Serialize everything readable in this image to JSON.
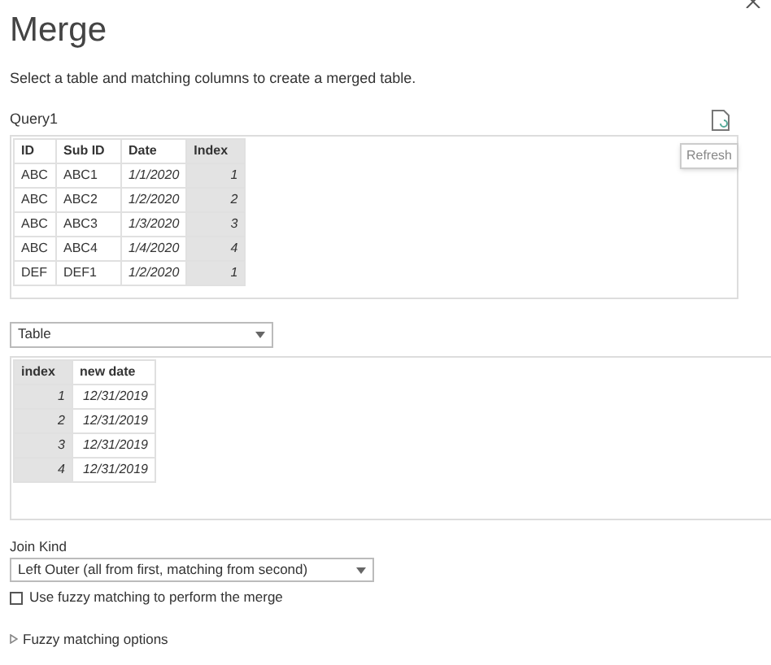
{
  "title": "Merge",
  "description": "Select a table and matching columns to create a merged table.",
  "first_table": {
    "name": "Query1",
    "refresh_tooltip": "Refresh",
    "columns": [
      {
        "label": "ID",
        "selected": false,
        "kind": "text"
      },
      {
        "label": "Sub ID",
        "selected": false,
        "kind": "text"
      },
      {
        "label": "Date",
        "selected": false,
        "kind": "value"
      },
      {
        "label": "Index",
        "selected": true,
        "kind": "value"
      }
    ],
    "rows": [
      [
        "ABC",
        "ABC1",
        "1/1/2020",
        "1"
      ],
      [
        "ABC",
        "ABC2",
        "1/2/2020",
        "2"
      ],
      [
        "ABC",
        "ABC3",
        "1/3/2020",
        "3"
      ],
      [
        "ABC",
        "ABC4",
        "1/4/2020",
        "4"
      ],
      [
        "DEF",
        "DEF1",
        "1/2/2020",
        "1"
      ]
    ]
  },
  "second_table": {
    "dropdown": "Table",
    "columns": [
      {
        "label": "index",
        "selected": true,
        "kind": "value"
      },
      {
        "label": "new date",
        "selected": false,
        "kind": "value"
      }
    ],
    "rows": [
      [
        "1",
        "12/31/2019"
      ],
      [
        "2",
        "12/31/2019"
      ],
      [
        "3",
        "12/31/2019"
      ],
      [
        "4",
        "12/31/2019"
      ]
    ]
  },
  "join_kind": {
    "label": "Join Kind",
    "value": "Left Outer (all from first, matching from second)"
  },
  "fuzzy": {
    "label": "Use fuzzy matching to perform the merge",
    "checked": false,
    "options_label": "Fuzzy matching options",
    "expanded": false
  }
}
